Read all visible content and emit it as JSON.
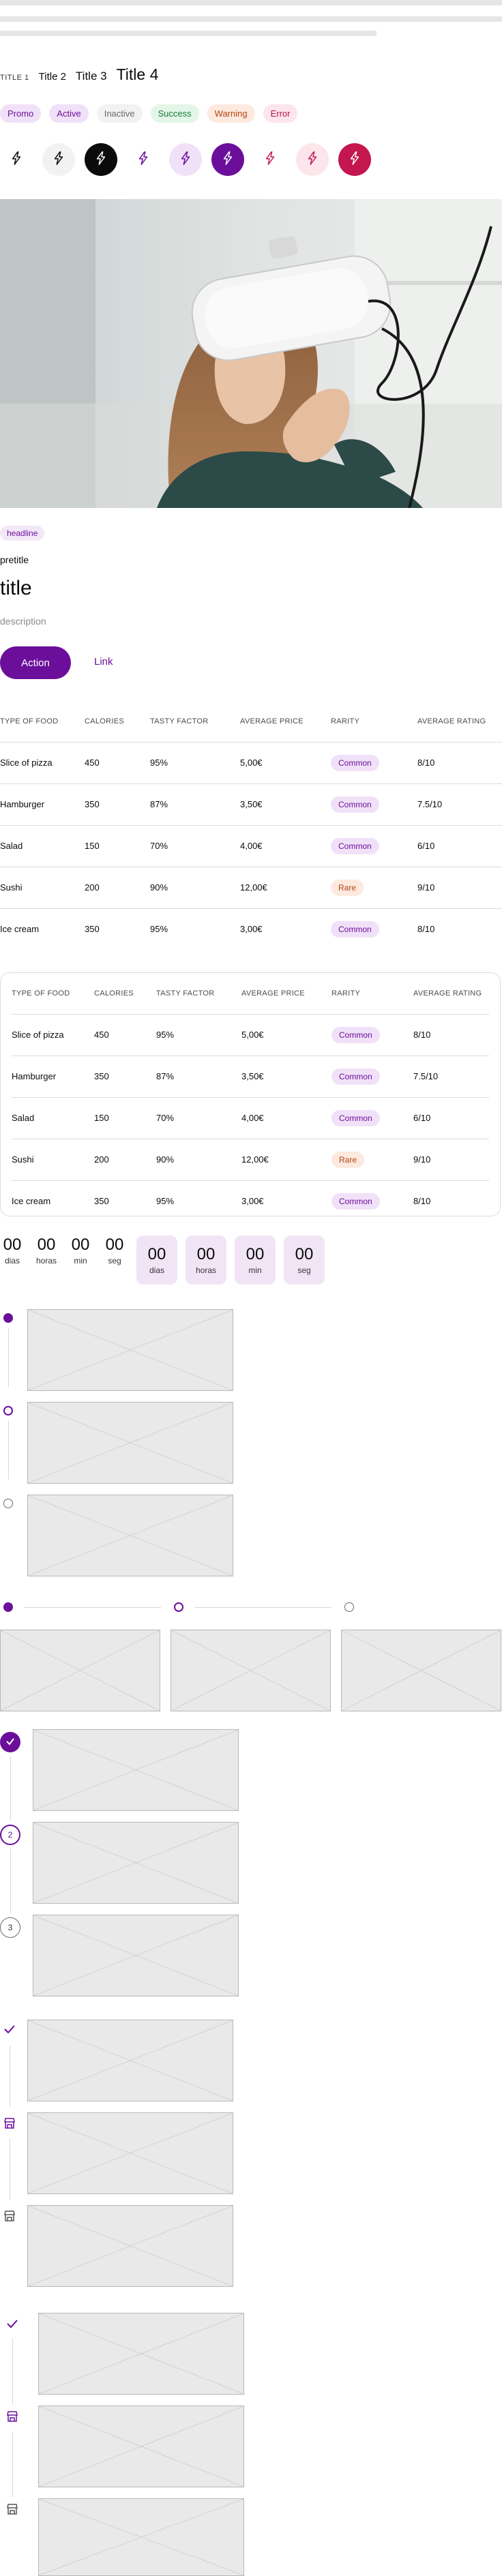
{
  "titles": {
    "t1": "TITLE 1",
    "t2": "Title 2",
    "t3": "Title 3",
    "t4": "Title 4"
  },
  "tags": [
    {
      "label": "Promo",
      "bg": "#f1e1f8",
      "fg": "#6b0f9b"
    },
    {
      "label": "Active",
      "bg": "#f1e1f8",
      "fg": "#6b0f9b"
    },
    {
      "label": "Inactive",
      "bg": "#f2f2f2",
      "fg": "#6a6a6a"
    },
    {
      "label": "Success",
      "bg": "#e3f6e8",
      "fg": "#177a3b"
    },
    {
      "label": "Warning",
      "bg": "#fde9de",
      "fg": "#b24510"
    },
    {
      "label": "Error",
      "bg": "#fde5ec",
      "fg": "#b3134a"
    }
  ],
  "icon_buttons": [
    {
      "icon": "lightning-icon",
      "bg": "#ffffff",
      "fg": "#0b0b0b"
    },
    {
      "icon": "lightning-icon",
      "bg": "#f2f2f2",
      "fg": "#0b0b0b"
    },
    {
      "icon": "lightning-icon",
      "bg": "#0b0b0b",
      "fg": "#ffffff"
    },
    {
      "icon": "lightning-icon",
      "bg": "#ffffff",
      "fg": "#6b0f9b"
    },
    {
      "icon": "lightning-icon",
      "bg": "#f1e1f8",
      "fg": "#6b0f9b"
    },
    {
      "icon": "lightning-icon",
      "bg": "#6b0f9b",
      "fg": "#ffffff"
    },
    {
      "icon": "lightning-icon",
      "bg": "#ffffff",
      "fg": "#c21b5a"
    },
    {
      "icon": "lightning-icon",
      "bg": "#fde5ec",
      "fg": "#c21b5a"
    },
    {
      "icon": "lightning-icon",
      "bg": "#c4164f",
      "fg": "#ffffff"
    }
  ],
  "card": {
    "headline": "headline",
    "pretitle": "pretitle",
    "title": "title",
    "description": "description",
    "action_label": "Action",
    "link_label": "Link"
  },
  "table": {
    "headers": [
      "TYPE OF FOOD",
      "CALORIES",
      "TASTY FACTOR",
      "AVERAGE PRICE",
      "RARITY",
      "AVERAGE RATING"
    ],
    "rows": [
      {
        "food": "Slice of pizza",
        "calories": "450",
        "tasty": "95%",
        "price": "5,00€",
        "rarity": "Common",
        "rating": "8/10"
      },
      {
        "food": "Hamburger",
        "calories": "350",
        "tasty": "87%",
        "price": "3,50€",
        "rarity": "Common",
        "rating": "7.5/10"
      },
      {
        "food": "Salad",
        "calories": "150",
        "tasty": "70%",
        "price": "4,00€",
        "rarity": "Common",
        "rating": "6/10"
      },
      {
        "food": "Sushi",
        "calories": "200",
        "tasty": "90%",
        "price": "12,00€",
        "rarity": "Rare",
        "rating": "9/10"
      },
      {
        "food": "Ice cream",
        "calories": "350",
        "tasty": "95%",
        "price": "3,00€",
        "rarity": "Common",
        "rating": "8/10"
      }
    ],
    "rarity_colors": {
      "Common": {
        "bg": "#f1e1f8",
        "fg": "#6b0f9b"
      },
      "Rare": {
        "bg": "#fde9de",
        "fg": "#b24510"
      }
    }
  },
  "countdown": {
    "plain": [
      {
        "value": "00",
        "label": "dias"
      },
      {
        "value": "00",
        "label": "horas"
      },
      {
        "value": "00",
        "label": "min"
      },
      {
        "value": "00",
        "label": "seg"
      }
    ],
    "boxed": [
      {
        "value": "00",
        "label": "dias"
      },
      {
        "value": "00",
        "label": "horas"
      },
      {
        "value": "00",
        "label": "min"
      },
      {
        "value": "00",
        "label": "seg"
      }
    ]
  },
  "stepper": {
    "numbered": [
      "",
      "2",
      "3"
    ]
  },
  "colors": {
    "accent": "#6b0f9b",
    "accent_light": "#f1e1f8"
  }
}
